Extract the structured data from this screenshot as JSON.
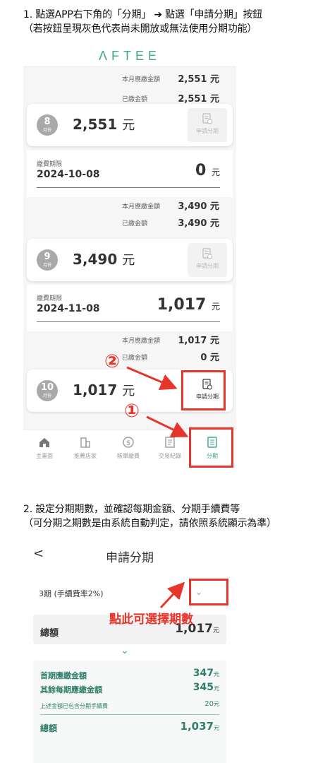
{
  "step1": {
    "line1": "1. 點選APP右下角的「分期」 ➔ 點選「申請分期」按鈕",
    "line2": "（若按鈕呈現灰色代表尚未開放或無法使用分期功能）"
  },
  "app": {
    "logo": "ΛFTEE",
    "top_rows": [
      {
        "label": "本月應繳金額",
        "value": "2,551 元"
      },
      {
        "label": "已繳金額",
        "value": "2,551 元"
      }
    ],
    "months": [
      {
        "month_num": "8",
        "month_unit": "月份",
        "amount": "2,551",
        "yuan": "元",
        "apply_label": "申請分期",
        "period_label": "繳費期限",
        "period_date": "2024-10-08",
        "period_amount": "0",
        "period_yuan": "元",
        "rows": [
          {
            "label": "本月應繳金額",
            "value": "3,490 元"
          },
          {
            "label": "已繳金額",
            "value": "3,490 元"
          }
        ]
      },
      {
        "month_num": "9",
        "month_unit": "月份",
        "amount": "3,490",
        "yuan": "元",
        "apply_label": "申請分期",
        "period_label": "繳費期限",
        "period_date": "2024-11-08",
        "period_amount": "1,017",
        "period_yuan": "元",
        "rows": [
          {
            "label": "本月應繳金額",
            "value": "1,017 元"
          },
          {
            "label": "已繳金額",
            "value": "0 元"
          }
        ]
      },
      {
        "month_num": "10",
        "month_unit": "月份",
        "amount": "1,017",
        "yuan": "元",
        "apply_label": "申請分期"
      }
    ],
    "tabs": [
      {
        "label": "主畫面",
        "icon": "home-icon"
      },
      {
        "label": "推薦店家",
        "icon": "store-icon"
      },
      {
        "label": "帳單繳費",
        "icon": "dollar-icon"
      },
      {
        "label": "交易紀錄",
        "icon": "record-icon"
      },
      {
        "label": "分期",
        "icon": "installment-icon"
      }
    ],
    "annotation_1": "①",
    "annotation_2": "②"
  },
  "step2": {
    "line1": "2. 設定分期期數，並確認每期金額、分期手續費等",
    "line2": "（可分期之期數是由系統自動判定，請依照系統顯示為準）"
  },
  "screen2": {
    "title": "申請分期",
    "back": "<",
    "select_value": "3期 (手續費率2%)",
    "hint": "點此可選擇期數",
    "total_label": "總額",
    "total_value": "1,017",
    "yuan": "元",
    "details": [
      {
        "label": "首期應繳金額",
        "value": "347"
      },
      {
        "label": "其餘每期應繳金額",
        "value": "345"
      },
      {
        "label": "上述金額已包含分期手續費",
        "value": "20"
      }
    ],
    "grand_total_label": "總額",
    "grand_total_value": "1,037"
  },
  "colors": {
    "brand": "#3aa98f",
    "annotation_red": "#e8352b",
    "detail_green": "#2f7f6b"
  }
}
